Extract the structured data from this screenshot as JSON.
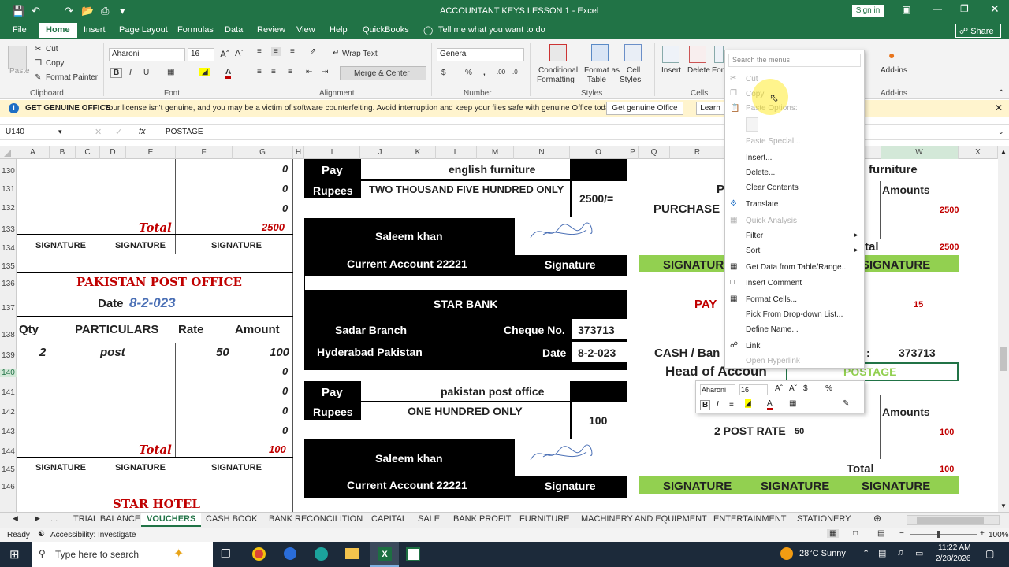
{
  "window": {
    "title": "ACCOUNTANT KEYS LESSON 1  -  Excel",
    "signin": "Sign in"
  },
  "menu": {
    "tabs": [
      "File",
      "Home",
      "Insert",
      "Page Layout",
      "Formulas",
      "Data",
      "Review",
      "View",
      "Help",
      "QuickBooks"
    ],
    "tell_me": "Tell me what you want to do",
    "share": "Share"
  },
  "ribbon": {
    "paste": "Paste",
    "cut": "Cut",
    "copy": "Copy",
    "format_painter": "Format Painter",
    "clipboard": "Clipboard",
    "font_name": "Aharoni",
    "font_size": "16",
    "font": "Font",
    "wrap_text": "Wrap Text",
    "merge_center": "Merge & Center",
    "alignment": "Alignment",
    "number_format": "General",
    "number": "Number",
    "cond_fmt_1": "Conditional",
    "cond_fmt_2": "Formatting",
    "fmt_table_1": "Format as",
    "fmt_table_2": "Table",
    "cell_styles_1": "Cell",
    "cell_styles_2": "Styles",
    "styles": "Styles",
    "insert": "Insert",
    "delete": "Delete",
    "format": "Forr",
    "cells": "Cells",
    "addins": "Add-ins",
    "addins_group": "Add-ins"
  },
  "infobar": {
    "title": "GET GENUINE OFFICE",
    "message": "Your license isn't genuine, and you may be a victim of software counterfeiting. Avoid interruption and keep your files safe with genuine Office today.",
    "button": "Get genuine Office",
    "learn": "Learn"
  },
  "formula": {
    "namebox": "U140",
    "fx": "fx",
    "value": "POSTAGE"
  },
  "columns": [
    "A",
    "B",
    "C",
    "D",
    "E",
    "F",
    "G",
    "H",
    "I",
    "J",
    "K",
    "L",
    "M",
    "N",
    "O",
    "P",
    "Q",
    "R",
    "W",
    "X"
  ],
  "rows": [
    "130",
    "131",
    "132",
    "133",
    "134",
    "135",
    "136",
    "137",
    "138",
    "139",
    "140",
    "141",
    "142",
    "143",
    "144",
    "145",
    "146"
  ],
  "left": {
    "zero": "0",
    "total_label": "Total",
    "total_1": "2500",
    "signature": "SIGNATURE",
    "post_office": "PAKISTAN POST OFFICE",
    "date_label": "Date",
    "date_value": "8-2-023",
    "qty": "Qty",
    "particulars": "PARTICULARS",
    "rate": "Rate",
    "amount": "Amount",
    "qty_val": "2",
    "part_val": "post",
    "rate_val": "50",
    "amount_val": "100",
    "total_2": "100",
    "star_hotel": "STAR HOTEL"
  },
  "cheque1": {
    "pay": "Pay",
    "payee": "english furniture",
    "rupees": "Rupees",
    "words": "TWO THOUSAND FIVE HUNDRED ONLY",
    "amount": "2500/=",
    "name": "Saleem khan",
    "account": "Current Account 22221",
    "signature": "Signature"
  },
  "bank": {
    "name": "STAR BANK",
    "branch": "Sadar Branch",
    "cheque_label": "Cheque No.",
    "cheque_no": "373713",
    "city": "Hyderabad Pakistan",
    "date_label": "Date",
    "date": "8-2-023"
  },
  "cheque2": {
    "pay": "Pay",
    "payee": "pakistan post office",
    "rupees": "Rupees",
    "words": "ONE HUNDRED ONLY",
    "amount": "100",
    "name": "Saleem khan",
    "account": "Current Account 22221",
    "signature": "Signature"
  },
  "right": {
    "furniture": "furniture",
    "p": "P",
    "amounts": "Amounts",
    "purchase": "PURCHASE",
    "val_2500": "2500",
    "tal": "tal",
    "signature": "SIGNATURE",
    "pay": "PAY",
    "fifteen": "15",
    "cash_bank": "CASH / Ban",
    "cheque_no": "373713",
    "colon": ":",
    "head": "Head of Accoun",
    "postage": "POSTAGE",
    "amounts2": "Amounts",
    "post_rate": "2 POST RATE",
    "rate50": "50",
    "val_100": "100",
    "total": "Total"
  },
  "context_menu": {
    "search": "Search the menus",
    "items": [
      "Cut",
      "Copy",
      "Paste Options:",
      "Paste Special...",
      "Insert...",
      "Delete...",
      "Clear Contents",
      "Translate",
      "Quick Analysis",
      "Filter",
      "Sort",
      "Get Data from Table/Range...",
      "Insert Comment",
      "Format Cells...",
      "Pick From Drop-down List...",
      "Define Name...",
      "Link",
      "Open Hyperlink"
    ]
  },
  "mini_toolbar": {
    "font": "Aharoni",
    "size": "16"
  },
  "sheets": [
    "...",
    "TRIAL BALANCE",
    "VOUCHERS",
    "CASH BOOK",
    "BANK RECONCILITION",
    "CAPITAL",
    "SALE",
    "BANK PROFIT",
    "FURNITURE",
    "MACHINERY AND EQUIPMENT",
    "ENTERTAINMENT",
    "STATIONERY"
  ],
  "status": {
    "ready": "Ready",
    "accessibility": "Accessibility: Investigate",
    "zoom": "100%"
  },
  "taskbar": {
    "search": "Type here to search",
    "weather": "28°C  Sunny",
    "time": "11:22 AM",
    "date": "2/28/2026"
  },
  "colors": {
    "excel_green": "#217346",
    "cell_green": "#92d050",
    "red": "#c00000"
  }
}
